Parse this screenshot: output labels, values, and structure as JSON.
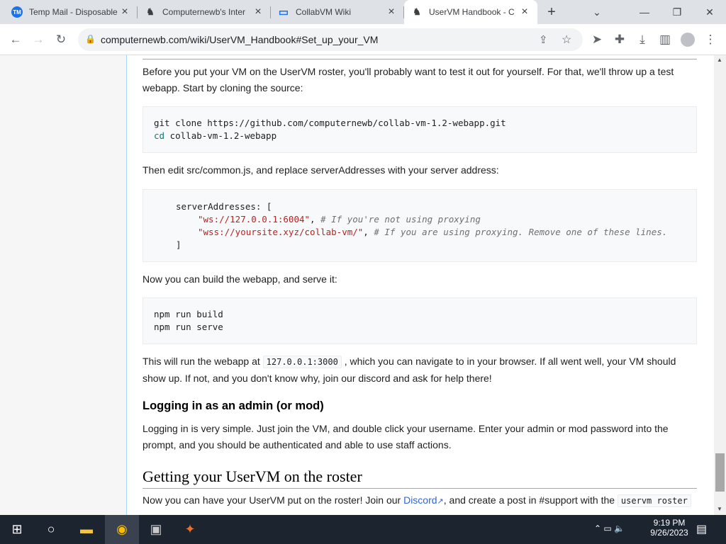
{
  "browser": {
    "tabs": [
      {
        "label": "Temp Mail - Disposable",
        "icon": "TM"
      },
      {
        "label": "Computernewb's Inter",
        "icon": "♞"
      },
      {
        "label": "CollabVM Wiki",
        "icon": "▭"
      },
      {
        "label": "UserVM Handbook - C",
        "icon": "♞"
      }
    ],
    "close": "×",
    "new_tab": "+",
    "url": "computernewb.com/wiki/UserVM_Handbook#Set_up_your_VM"
  },
  "article": {
    "intro": "Before you put your VM on the UserVM roster, you'll probably want to test it out for yourself. For that, we'll throw up a test",
    "intro2": "webapp. Start by cloning the source:",
    "clone": {
      "l1": "git clone https://github.com/computernewb/collab-vm-1.2-webapp.git",
      "l2": "cd",
      "l2b": " collab-vm-1.2-webapp"
    },
    "edit": "Then edit src/common.js, and replace serverAddresses with your server address:",
    "cfg": {
      "l1": "serverAddresses: [",
      "a1": "\"ws://127.0.0.1:6004\"",
      "c1": "# If you're not using proxying",
      "a2": "\"wss://yoursite.xyz/collab-vm/\"",
      "c2": "# If you are using proxying. Remove one of these lines.",
      "l4": "]"
    },
    "build": "Now you can build the webapp, and serve it:",
    "b1": "npm run build",
    "b2": "npm run serve",
    "run": {
      "pre": "This will run the webapp at",
      "code": "127.0.0.1:3000",
      "post": ", which you can navigate to in your browser. If all went well, your VM should",
      "l2": "show up. If not, and you don't know why, join our discord and ask for help there!"
    },
    "h_admin": "Logging in as an admin (or mod)",
    "admin1": "Logging in is very simple. Just join the VM, and double click your username. Enter your admin or mod password into the",
    "admin2": "prompt, and you should be authenticated and able to use staff actions.",
    "h_roster": "Getting your UserVM on the roster",
    "roster": {
      "pre": "Now you can have your UserVM put on the roster! Join our",
      "link": "Discord",
      "post": ", and create a post in #support with the",
      "code": "uservm roster"
    }
  },
  "taskbar": {
    "time": "9:19 PM",
    "date": "9/26/2023"
  },
  "colors": {
    "accent": "#3366cc"
  }
}
